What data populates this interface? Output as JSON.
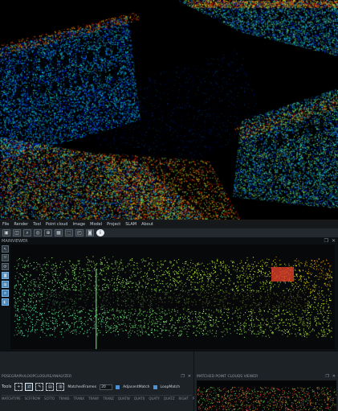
{
  "menubar": {
    "items": [
      "File",
      "Render",
      "Tool",
      "Point cloud",
      "Image",
      "Model",
      "Project",
      "SLAM",
      "About"
    ]
  },
  "toolbar": {
    "buttons": [
      {
        "name": "save-icon",
        "glyph": "▣",
        "active": false
      },
      {
        "name": "open-folder-icon",
        "glyph": "◫",
        "active": false
      },
      {
        "name": "zoom-icon",
        "glyph": "⌕",
        "active": false
      },
      {
        "name": "orbit-icon",
        "glyph": "◎",
        "active": false
      },
      {
        "name": "globe-icon",
        "glyph": "⊕",
        "active": false
      },
      {
        "name": "grid-icon",
        "glyph": "▦",
        "active": false
      },
      {
        "name": "select-icon",
        "glyph": "⬚",
        "active": false
      },
      {
        "name": "layers-icon",
        "glyph": "◰",
        "active": false
      },
      {
        "name": "camera-icon",
        "glyph": "◙",
        "active": false
      },
      {
        "name": "info-icon",
        "glyph": "i",
        "active": true
      }
    ]
  },
  "main_viewer": {
    "title": "MAINVIEWER",
    "controls": [
      "❐",
      "✕"
    ],
    "side_tools": [
      {
        "name": "pointer-tool-icon",
        "glyph": "↖",
        "blue": false
      },
      {
        "name": "fit-view-tool-icon",
        "glyph": "⤧",
        "blue": false
      },
      {
        "name": "rotate-tool-icon",
        "glyph": "⟳",
        "blue": false
      },
      {
        "name": "camera-tool-icon",
        "glyph": "◙",
        "blue": true
      },
      {
        "name": "grid-tool-icon",
        "glyph": "▦",
        "blue": true
      },
      {
        "name": "align-tool-icon",
        "glyph": "≡",
        "blue": true
      },
      {
        "name": "measure-tool-icon",
        "glyph": "◧",
        "blue": true
      }
    ]
  },
  "left_panel": {
    "title": "POSEGRAPH/LOOPCLOSURE/ANALYZER",
    "controls": [
      "❐",
      "✕"
    ],
    "tools_label": "Tools",
    "tools": [
      {
        "name": "add-node-icon",
        "glyph": "+",
        "selected": false
      },
      {
        "name": "link-tool-icon",
        "glyph": "⇄",
        "selected": true
      },
      {
        "name": "edit-tool-icon",
        "glyph": "✎",
        "selected": false
      },
      {
        "name": "table-tool-icon",
        "glyph": "▤",
        "selected": false
      },
      {
        "name": "chart-tool-icon",
        "glyph": "▥",
        "selected": false
      }
    ],
    "match_label": "MatchedFrames",
    "match_value": "20",
    "adjacent_label": "AdjacentMatch",
    "adjacent_checked": true,
    "loop_label": "LoopMatch",
    "loop_checked": true,
    "columns": [
      "MATCHTYPE",
      "SCFFROM",
      "SCFTO",
      "TRANS",
      "TRANX",
      "TRANY",
      "TRANZ",
      "QUATW",
      "QUATX",
      "QUATY",
      "QUATZ",
      "RIGHT",
      "REVSORTED"
    ]
  },
  "right_panel": {
    "title": "MATCHED POINT CLOUDS VIEWER",
    "controls": [
      "❐",
      "✕"
    ]
  }
}
